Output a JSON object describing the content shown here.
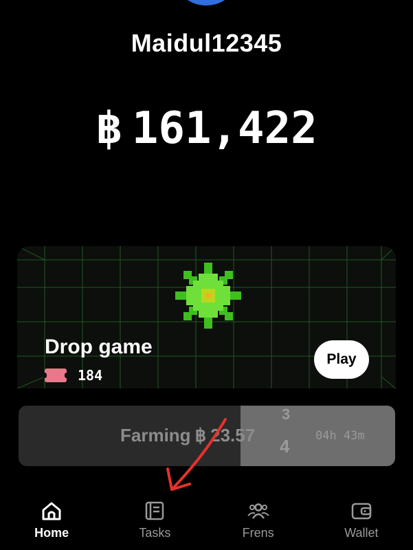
{
  "profile": {
    "username": "Maidul12345"
  },
  "balance": {
    "symbol": "฿",
    "amount": "161,422"
  },
  "drop_game": {
    "title": "Drop game",
    "tickets": "184",
    "play_label": "Play"
  },
  "farming": {
    "label": "Farming",
    "symbol": "฿",
    "amount": "23.57",
    "rolling_digit_top": "3",
    "rolling_digit_bottom": "4",
    "time_left": "04h 43m",
    "progress": 0.41
  },
  "nav": {
    "items": [
      {
        "label": "Home",
        "icon": "home-icon",
        "active": true
      },
      {
        "label": "Tasks",
        "icon": "tasks-icon",
        "active": false
      },
      {
        "label": "Frens",
        "icon": "frens-icon",
        "active": false
      },
      {
        "label": "Wallet",
        "icon": "wallet-icon",
        "active": false
      }
    ]
  },
  "colors": {
    "accent": "#2f6fe0",
    "annotation_arrow": "#e5322b",
    "gem": "#5fdc2a"
  }
}
